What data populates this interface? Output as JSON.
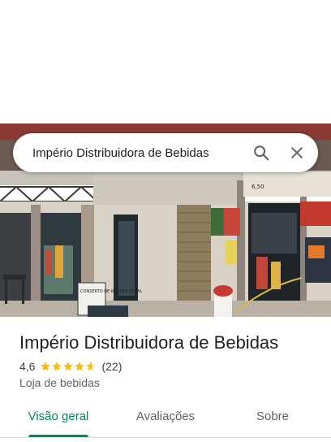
{
  "search": {
    "query": "Império Distribuidora de Bebidas",
    "search_icon": "search-icon",
    "close_icon": "close-icon"
  },
  "photo": {
    "signs": [
      "CONSERTO DE ROUPAS GERAL",
      "6,50"
    ]
  },
  "place": {
    "name": "Império Distribuidora de Bebidas",
    "rating_text": "4,6",
    "rating": 4.6,
    "review_count": "(22)",
    "category": "Loja de bebidas"
  },
  "tabs": [
    {
      "label": "Visão geral",
      "active": true
    },
    {
      "label": "Avaliações",
      "active": false
    },
    {
      "label": "Sobre",
      "active": false
    }
  ],
  "colors": {
    "accent": "#01875f",
    "star": "#fbbc04",
    "star_empty": "#dadce0"
  }
}
